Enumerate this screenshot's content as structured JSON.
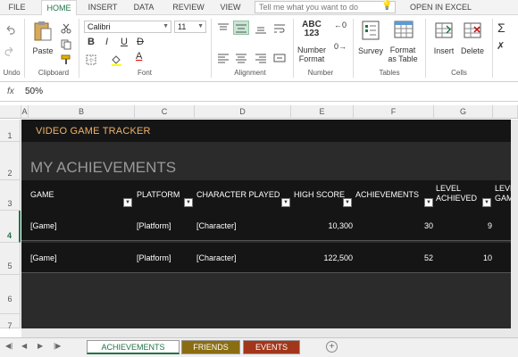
{
  "menu": {
    "tabs": [
      "FILE",
      "HOME",
      "INSERT",
      "DATA",
      "REVIEW",
      "VIEW"
    ],
    "active_tab": "HOME",
    "tell_me_placeholder": "Tell me what you want to do",
    "open_in_excel": "OPEN IN EXCEL"
  },
  "ribbon": {
    "groups": {
      "undo": "Undo",
      "clipboard": "Clipboard",
      "font": "Font",
      "alignment": "Alignment",
      "number": "Number",
      "tables": "Tables",
      "cells": "Cells"
    },
    "paste_label": "Paste",
    "font_name": "Calibri",
    "font_size": "11",
    "bold": "B",
    "italic": "I",
    "underline": "U",
    "strike": "D",
    "font_color_letter": "A",
    "number_icon": "ABC\n123",
    "number_label_1": "Number",
    "number_label_2": "Format",
    "survey_label": "Survey",
    "format_table_1": "Format",
    "format_table_2": "as Table",
    "insert_label": "Insert",
    "delete_label": "Delete"
  },
  "formula_bar": {
    "fx": "fx",
    "value": "50%"
  },
  "columns": [
    "A",
    "B",
    "C",
    "D",
    "E",
    "F",
    "G"
  ],
  "rows": [
    "1",
    "2",
    "3",
    "4",
    "5",
    "6",
    "7"
  ],
  "selected_row": "4",
  "sheet": {
    "banner": "VIDEO GAME TRACKER",
    "heading": "MY ACHIEVEMENTS",
    "headers": {
      "game": "GAME",
      "platform": "PLATFORM",
      "character": "CHARACTER PLAYED",
      "high_score": "HIGH SCORE",
      "achievements": "ACHIEVEMENTS",
      "level_1": "LEVEL",
      "level_2": "ACHIEVED",
      "extra_1": "LEVE",
      "extra_2": "GAM"
    },
    "rows": [
      {
        "game": "[Game]",
        "platform": "[Platform]",
        "character": "[Character]",
        "high_score": "10,300",
        "achievements": "30",
        "level": "9"
      },
      {
        "game": "[Game]",
        "platform": "[Platform]",
        "character": "[Character]",
        "high_score": "122,500",
        "achievements": "52",
        "level": "10"
      }
    ]
  },
  "sheet_tabs": {
    "achievements": "ACHIEVEMENTS",
    "friends": "FRIENDS",
    "events": "EVENTS",
    "add": "+"
  },
  "colors": {
    "excel_green": "#217346",
    "banner_text": "#f0b36b",
    "friends_tab": "#8b6d11",
    "events_tab": "#a3361a"
  }
}
